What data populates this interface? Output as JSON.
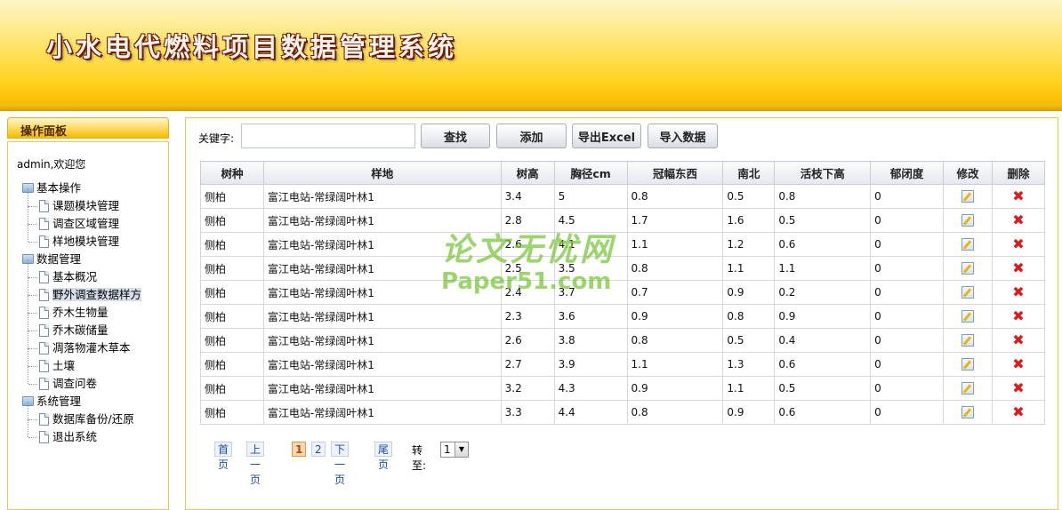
{
  "header": {
    "title": "小水电代燃料项目数据管理系统"
  },
  "sidebar": {
    "panel_title": "操作面板",
    "welcome": "admin,欢迎您",
    "groups": [
      {
        "label": "基本操作",
        "items": [
          {
            "label": "课题模块管理"
          },
          {
            "label": "调查区域管理"
          },
          {
            "label": "样地模块管理"
          }
        ]
      },
      {
        "label": "数据管理",
        "items": [
          {
            "label": "基本概况"
          },
          {
            "label": "野外调查数据样方"
          },
          {
            "label": "乔木生物量"
          },
          {
            "label": "乔木碳储量"
          },
          {
            "label": "凋落物灌木草本"
          },
          {
            "label": "土壤"
          },
          {
            "label": "调查问卷"
          }
        ]
      },
      {
        "label": "系统管理",
        "items": [
          {
            "label": "数据库备份/还原"
          },
          {
            "label": "退出系统"
          }
        ]
      }
    ],
    "active_item": "野外调查数据样方"
  },
  "toolbar": {
    "keyword_label": "关键字:",
    "keyword_value": "",
    "search_btn": "查找",
    "add_btn": "添加",
    "export_btn": "导出Excel",
    "import_btn": "导入数据"
  },
  "table": {
    "headers": [
      "树种",
      "样地",
      "树高",
      "胸径cm",
      "冠幅东西",
      "南北",
      "活枝下高",
      "郁闭度",
      "修改",
      "删除"
    ],
    "rows": [
      [
        "侧柏",
        "富江电站-常绿阔叶林1",
        "3.4",
        "5",
        "0.8",
        "0.5",
        "0.8",
        "0"
      ],
      [
        "侧柏",
        "富江电站-常绿阔叶林1",
        "2.8",
        "4.5",
        "1.7",
        "1.6",
        "0.5",
        "0"
      ],
      [
        "侧柏",
        "富江电站-常绿阔叶林1",
        "2.6",
        "4.1",
        "1.1",
        "1.2",
        "0.6",
        "0"
      ],
      [
        "侧柏",
        "富江电站-常绿阔叶林1",
        "2.5",
        "3.5",
        "0.8",
        "1.1",
        "1.1",
        "0"
      ],
      [
        "侧柏",
        "富江电站-常绿阔叶林1",
        "2.4",
        "3.7",
        "0.7",
        "0.9",
        "0.2",
        "0"
      ],
      [
        "侧柏",
        "富江电站-常绿阔叶林1",
        "2.3",
        "3.6",
        "0.9",
        "0.8",
        "0.9",
        "0"
      ],
      [
        "侧柏",
        "富江电站-常绿阔叶林1",
        "2.6",
        "3.8",
        "0.8",
        "0.5",
        "0.4",
        "0"
      ],
      [
        "侧柏",
        "富江电站-常绿阔叶林1",
        "2.7",
        "3.9",
        "1.1",
        "1.3",
        "0.6",
        "0"
      ],
      [
        "侧柏",
        "富江电站-常绿阔叶林1",
        "3.2",
        "4.3",
        "0.9",
        "1.1",
        "0.5",
        "0"
      ],
      [
        "侧柏",
        "富江电站-常绿阔叶林1",
        "3.3",
        "4.4",
        "0.8",
        "0.9",
        "0.6",
        "0"
      ]
    ],
    "edit_icon": "edit-icon",
    "delete_icon": "delete-icon"
  },
  "pager": {
    "first": "首页",
    "prev": "上一页",
    "pages": [
      "1",
      "2"
    ],
    "current": "1",
    "next": "下一页",
    "last": "尾页",
    "goto_label": "转至:",
    "goto_value": "1"
  },
  "watermark": {
    "line1": "论文无忧网",
    "line2": "Paper51.com"
  },
  "colors": {
    "header_yellow": "#ffd21c",
    "border_gold": "#f0c64c",
    "delete_red": "#e01818",
    "link_blue": "#1d4fa0"
  }
}
